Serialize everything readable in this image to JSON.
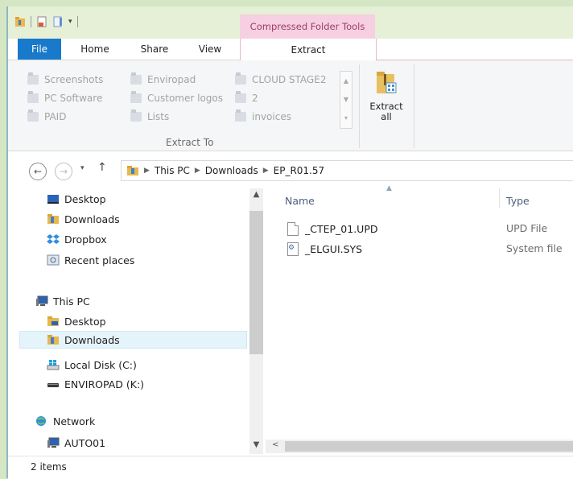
{
  "colors": {
    "file_tab": "#1979ca",
    "context_tab": "#f6cfe0",
    "context_text": "#9b3f6b",
    "selection": "#e5f3fb",
    "background": "#d4e6c4"
  },
  "ribbon": {
    "context_group": "Compressed Folder Tools",
    "tabs": {
      "file": "File",
      "home": "Home",
      "share": "Share",
      "view": "View",
      "extract": "Extract"
    },
    "destinations": [
      "Screenshots",
      "Enviropad",
      "CLOUD STAGE2",
      "PC Software",
      "Customer logos",
      "2",
      "PAID",
      "Lists",
      "invoices"
    ],
    "group_label": "Extract To",
    "extract_all": {
      "line1": "Extract",
      "line2": "all"
    }
  },
  "address": {
    "crumbs": [
      "This PC",
      "Downloads",
      "EP_R01.57"
    ]
  },
  "nav": {
    "quick": [
      "Desktop",
      "Downloads",
      "Dropbox",
      "Recent places"
    ],
    "this_pc": "This PC",
    "pc_children": [
      "Desktop",
      "Downloads",
      "Local Disk (C:)",
      "ENVIROPAD (K:)"
    ],
    "network": "Network",
    "network_children": [
      "AUTO01"
    ]
  },
  "files": {
    "columns": {
      "name": "Name",
      "type": "Type"
    },
    "rows": [
      {
        "name": "_CTEP_01.UPD",
        "type": "UPD File",
        "icon": "document-icon"
      },
      {
        "name": "_ELGUI.SYS",
        "type": "System file",
        "icon": "system-file-icon"
      }
    ]
  },
  "status": {
    "count": "2 items"
  }
}
